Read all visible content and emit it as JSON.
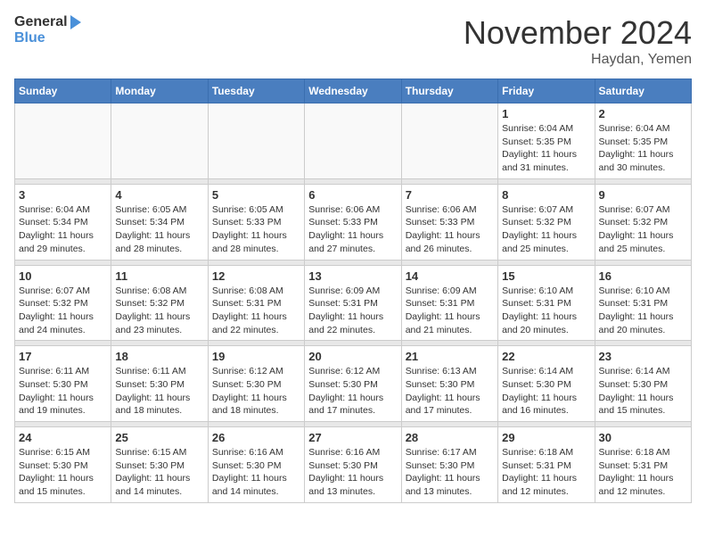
{
  "header": {
    "logo_general": "General",
    "logo_blue": "Blue",
    "month": "November 2024",
    "location": "Haydan, Yemen"
  },
  "weekdays": [
    "Sunday",
    "Monday",
    "Tuesday",
    "Wednesday",
    "Thursday",
    "Friday",
    "Saturday"
  ],
  "weeks": [
    [
      {
        "day": "",
        "info": ""
      },
      {
        "day": "",
        "info": ""
      },
      {
        "day": "",
        "info": ""
      },
      {
        "day": "",
        "info": ""
      },
      {
        "day": "",
        "info": ""
      },
      {
        "day": "1",
        "info": "Sunrise: 6:04 AM\nSunset: 5:35 PM\nDaylight: 11 hours and 31 minutes."
      },
      {
        "day": "2",
        "info": "Sunrise: 6:04 AM\nSunset: 5:35 PM\nDaylight: 11 hours and 30 minutes."
      }
    ],
    [
      {
        "day": "3",
        "info": "Sunrise: 6:04 AM\nSunset: 5:34 PM\nDaylight: 11 hours and 29 minutes."
      },
      {
        "day": "4",
        "info": "Sunrise: 6:05 AM\nSunset: 5:34 PM\nDaylight: 11 hours and 28 minutes."
      },
      {
        "day": "5",
        "info": "Sunrise: 6:05 AM\nSunset: 5:33 PM\nDaylight: 11 hours and 28 minutes."
      },
      {
        "day": "6",
        "info": "Sunrise: 6:06 AM\nSunset: 5:33 PM\nDaylight: 11 hours and 27 minutes."
      },
      {
        "day": "7",
        "info": "Sunrise: 6:06 AM\nSunset: 5:33 PM\nDaylight: 11 hours and 26 minutes."
      },
      {
        "day": "8",
        "info": "Sunrise: 6:07 AM\nSunset: 5:32 PM\nDaylight: 11 hours and 25 minutes."
      },
      {
        "day": "9",
        "info": "Sunrise: 6:07 AM\nSunset: 5:32 PM\nDaylight: 11 hours and 25 minutes."
      }
    ],
    [
      {
        "day": "10",
        "info": "Sunrise: 6:07 AM\nSunset: 5:32 PM\nDaylight: 11 hours and 24 minutes."
      },
      {
        "day": "11",
        "info": "Sunrise: 6:08 AM\nSunset: 5:32 PM\nDaylight: 11 hours and 23 minutes."
      },
      {
        "day": "12",
        "info": "Sunrise: 6:08 AM\nSunset: 5:31 PM\nDaylight: 11 hours and 22 minutes."
      },
      {
        "day": "13",
        "info": "Sunrise: 6:09 AM\nSunset: 5:31 PM\nDaylight: 11 hours and 22 minutes."
      },
      {
        "day": "14",
        "info": "Sunrise: 6:09 AM\nSunset: 5:31 PM\nDaylight: 11 hours and 21 minutes."
      },
      {
        "day": "15",
        "info": "Sunrise: 6:10 AM\nSunset: 5:31 PM\nDaylight: 11 hours and 20 minutes."
      },
      {
        "day": "16",
        "info": "Sunrise: 6:10 AM\nSunset: 5:31 PM\nDaylight: 11 hours and 20 minutes."
      }
    ],
    [
      {
        "day": "17",
        "info": "Sunrise: 6:11 AM\nSunset: 5:30 PM\nDaylight: 11 hours and 19 minutes."
      },
      {
        "day": "18",
        "info": "Sunrise: 6:11 AM\nSunset: 5:30 PM\nDaylight: 11 hours and 18 minutes."
      },
      {
        "day": "19",
        "info": "Sunrise: 6:12 AM\nSunset: 5:30 PM\nDaylight: 11 hours and 18 minutes."
      },
      {
        "day": "20",
        "info": "Sunrise: 6:12 AM\nSunset: 5:30 PM\nDaylight: 11 hours and 17 minutes."
      },
      {
        "day": "21",
        "info": "Sunrise: 6:13 AM\nSunset: 5:30 PM\nDaylight: 11 hours and 17 minutes."
      },
      {
        "day": "22",
        "info": "Sunrise: 6:14 AM\nSunset: 5:30 PM\nDaylight: 11 hours and 16 minutes."
      },
      {
        "day": "23",
        "info": "Sunrise: 6:14 AM\nSunset: 5:30 PM\nDaylight: 11 hours and 15 minutes."
      }
    ],
    [
      {
        "day": "24",
        "info": "Sunrise: 6:15 AM\nSunset: 5:30 PM\nDaylight: 11 hours and 15 minutes."
      },
      {
        "day": "25",
        "info": "Sunrise: 6:15 AM\nSunset: 5:30 PM\nDaylight: 11 hours and 14 minutes."
      },
      {
        "day": "26",
        "info": "Sunrise: 6:16 AM\nSunset: 5:30 PM\nDaylight: 11 hours and 14 minutes."
      },
      {
        "day": "27",
        "info": "Sunrise: 6:16 AM\nSunset: 5:30 PM\nDaylight: 11 hours and 13 minutes."
      },
      {
        "day": "28",
        "info": "Sunrise: 6:17 AM\nSunset: 5:30 PM\nDaylight: 11 hours and 13 minutes."
      },
      {
        "day": "29",
        "info": "Sunrise: 6:18 AM\nSunset: 5:31 PM\nDaylight: 11 hours and 12 minutes."
      },
      {
        "day": "30",
        "info": "Sunrise: 6:18 AM\nSunset: 5:31 PM\nDaylight: 11 hours and 12 minutes."
      }
    ]
  ]
}
